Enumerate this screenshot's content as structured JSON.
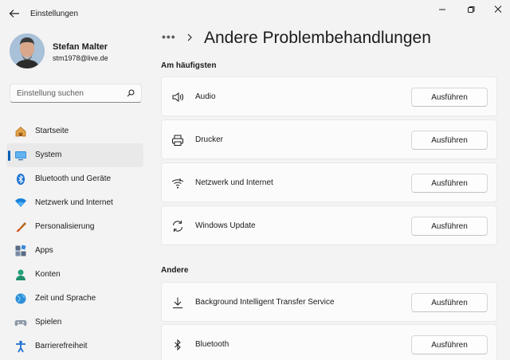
{
  "app": {
    "title": "Einstellungen"
  },
  "user": {
    "name": "Stefan Malter",
    "email": "stm1978@live.de"
  },
  "search": {
    "placeholder": "Einstellung suchen"
  },
  "nav": {
    "items": [
      {
        "label": "Startseite",
        "icon": "home-icon"
      },
      {
        "label": "System",
        "icon": "system-icon",
        "active": true
      },
      {
        "label": "Bluetooth und Geräte",
        "icon": "bluetooth-icon"
      },
      {
        "label": "Netzwerk und Internet",
        "icon": "network-icon"
      },
      {
        "label": "Personalisierung",
        "icon": "brush-icon"
      },
      {
        "label": "Apps",
        "icon": "apps-icon"
      },
      {
        "label": "Konten",
        "icon": "accounts-icon"
      },
      {
        "label": "Zeit und Sprache",
        "icon": "globe-icon"
      },
      {
        "label": "Spielen",
        "icon": "gamepad-icon"
      },
      {
        "label": "Barrierefreiheit",
        "icon": "accessibility-icon"
      }
    ]
  },
  "main": {
    "breadcrumb_more": "•••",
    "title": "Andere Problembehandlungen",
    "sections": [
      {
        "title": "Am häufigsten",
        "items": [
          {
            "label": "Audio",
            "icon": "speaker-icon",
            "button": "Ausführen"
          },
          {
            "label": "Drucker",
            "icon": "printer-icon",
            "button": "Ausführen"
          },
          {
            "label": "Netzwerk und Internet",
            "icon": "wifi-icon",
            "button": "Ausführen"
          },
          {
            "label": "Windows Update",
            "icon": "refresh-icon",
            "button": "Ausführen"
          }
        ]
      },
      {
        "title": "Andere",
        "items": [
          {
            "label": "Background Intelligent Transfer Service",
            "icon": "download-icon",
            "button": "Ausführen"
          },
          {
            "label": "Bluetooth",
            "icon": "bluetooth-icon",
            "button": "Ausführen"
          }
        ]
      }
    ]
  },
  "colors": {
    "accent": "#005fb8",
    "background": "#f3f3f3",
    "card": "#fbfbfb"
  }
}
